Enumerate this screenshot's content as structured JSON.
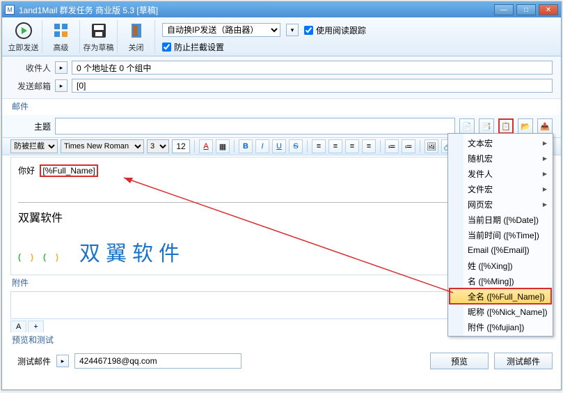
{
  "title": "1and1Mail 群发任务 商业版 5.3 [草稿]",
  "toolbar": {
    "send_now": "立即发送",
    "advanced": "高级",
    "save_draft": "存为草稿",
    "close": "关闭",
    "ip_mode": "自动换IP发送（路由器）",
    "use_read_track": "使用阅读跟踪",
    "block_intercept": "防止拦截设置"
  },
  "form": {
    "recipient_label": "收件人",
    "recipient_value": "0 个地址在 0 个组中",
    "sender_label": "发送邮箱",
    "sender_value": "[0]"
  },
  "mail_section": "邮件",
  "subject_label": "主题",
  "subject_value": "",
  "editor": {
    "antiblock": "防被拦截",
    "font": "Times New Roman",
    "size_sel": "3",
    "size_val": "12",
    "hello": "你好",
    "macro": "[%Full_Name]",
    "company": "双翼软件",
    "logo_text": "双翼软件"
  },
  "attach_label": "附件",
  "tabs": {
    "a": "A",
    "plus": "+"
  },
  "preview_section": "预览和测试",
  "test": {
    "label": "测试邮件",
    "value": "424467198@qq.com",
    "preview_btn": "预览",
    "send_btn": "测试邮件"
  },
  "menu": {
    "text_macro": "文本宏",
    "random_macro": "随机宏",
    "sender": "发件人",
    "file_macro": "文件宏",
    "web_macro": "网页宏",
    "date": "当前日期 ([%Date])",
    "time": "当前时间 ([%Time])",
    "email": "Email ([%Email])",
    "xing": "姓 ([%Xing])",
    "ming": "名 ([%Ming])",
    "fullname": "全名 ([%Full_Name])",
    "nick": "昵称 ([%Nick_Name])",
    "fujian": "附件 ([%fujian])"
  },
  "colors": {
    "accent_red": "#d62d2d",
    "link_blue": "#336699"
  }
}
